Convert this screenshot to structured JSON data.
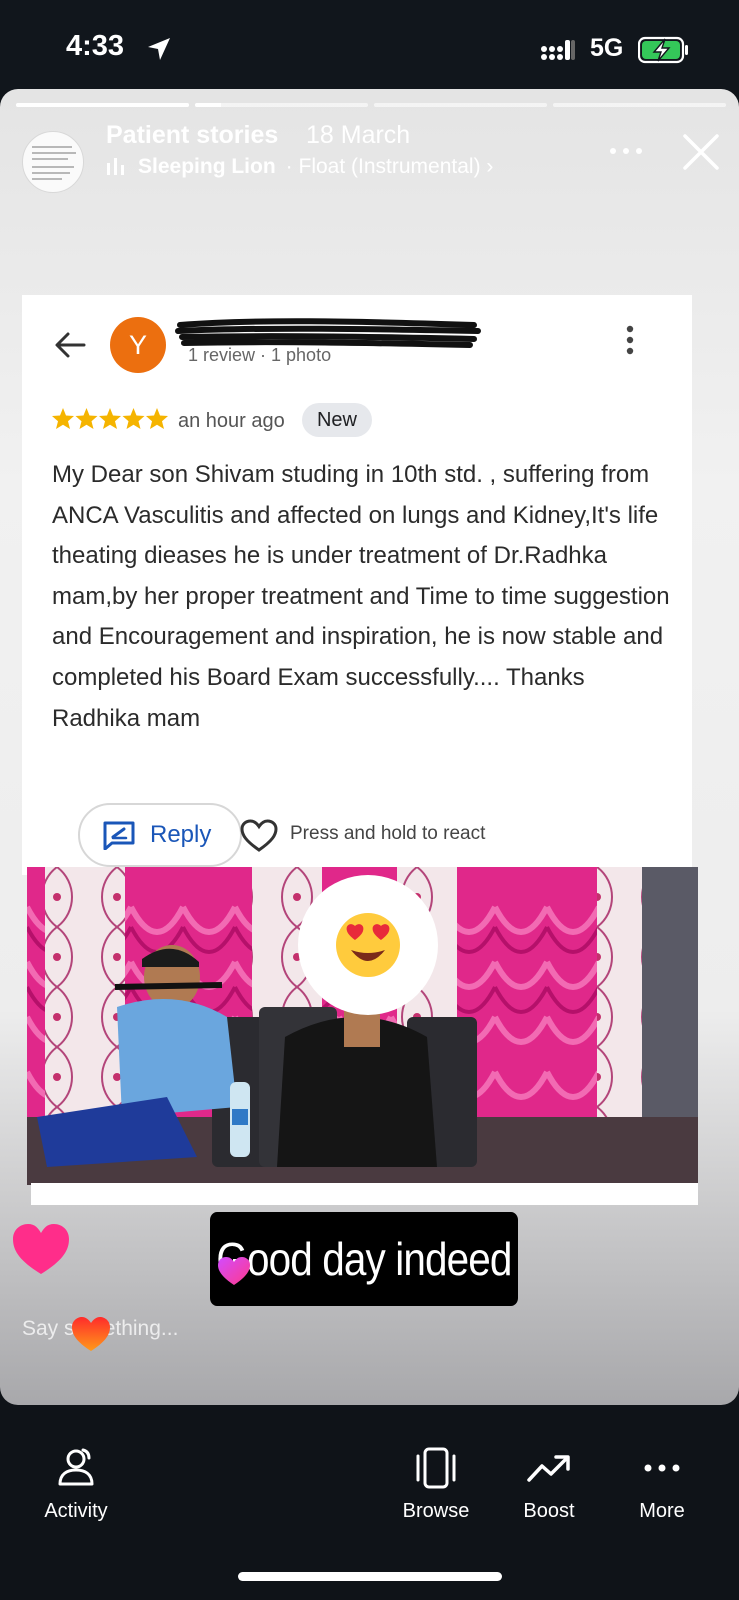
{
  "status_bar": {
    "time": "4:33",
    "network": "5G",
    "battery_charging": true
  },
  "story": {
    "progress_segments": [
      1,
      0.15,
      0,
      0
    ],
    "account_name": "Patient stories",
    "date": "18 March",
    "music_artist": "Sleeping Lion",
    "music_track": "· Float (Instrumental) ›"
  },
  "review": {
    "avatar_initial": "Y",
    "reviewer_meta": "1 review · 1 photo",
    "rating": 5,
    "time": "an hour ago",
    "badge": "New",
    "text": "My Dear son Shivam studing in 10th std. , suffering from ANCA Vasculitis and affected on lungs and Kidney,It's life theating dieases he is under treatment of Dr.Radhka mam,by her proper treatment and Time to time suggestion and Encouragement and inspiration, he is now stable and completed his Board Exam successfully.... Thanks Radhika mam",
    "reply_label": "Reply",
    "react_hint": "Press and hold to react"
  },
  "caption": "Good day indeed",
  "message_input": {
    "placeholder": "Say something..."
  },
  "bottom_nav": {
    "activity": "Activity",
    "browse": "Browse",
    "boost": "Boost",
    "more": "More"
  },
  "colors": {
    "avatar_orange": "#ec6f0f",
    "star_yellow": "#f5b400",
    "reply_blue": "#1a56b8",
    "curtain_pink": "#e0288a"
  },
  "icons": [
    "location-arrow-icon",
    "signal-icon",
    "battery-charging-icon",
    "music-bars-icon",
    "more-dots-icon",
    "close-icon",
    "back-arrow-icon",
    "kebab-icon",
    "star-icon",
    "reply-icon",
    "heart-outline-icon",
    "heart-eyes-emoji",
    "heart-sticker",
    "activity-icon",
    "browse-icon",
    "boost-icon",
    "more-icon"
  ]
}
